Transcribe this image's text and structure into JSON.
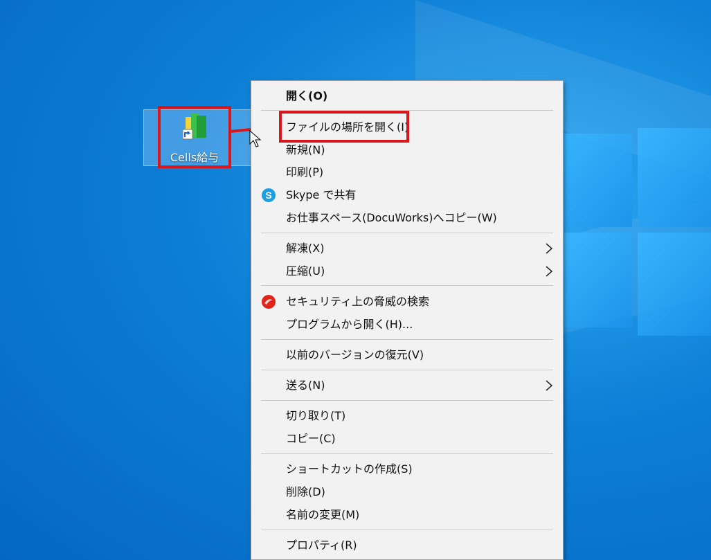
{
  "desktop": {
    "icon_label": "Cells給与",
    "icon_name": "cells-kyuyo-shortcut-icon"
  },
  "annotation": {
    "highlight_color": "#d8161b"
  },
  "menu": {
    "items": [
      {
        "label": "開く(O)",
        "bold": true
      },
      {
        "label": "ファイルの場所を開く(I)"
      },
      {
        "label": "新規(N)"
      },
      {
        "label": "印刷(P)"
      },
      {
        "label": "Skype で共有",
        "icon": "skype-icon"
      },
      {
        "label": "お仕事スペース(DocuWorks)へコピー(W)"
      },
      {
        "label": "解凍(X)",
        "submenu": true
      },
      {
        "label": "圧縮(U)",
        "submenu": true
      },
      {
        "label": "セキュリティ上の脅威の検索",
        "icon": "security-scan-icon"
      },
      {
        "label": "プログラムから開く(H)..."
      },
      {
        "label": "以前のバージョンの復元(V)"
      },
      {
        "label": "送る(N)",
        "submenu": true
      },
      {
        "label": "切り取り(T)"
      },
      {
        "label": "コピー(C)"
      },
      {
        "label": "ショートカットの作成(S)"
      },
      {
        "label": "削除(D)"
      },
      {
        "label": "名前の変更(M)"
      },
      {
        "label": "プロパティ(R)"
      }
    ]
  }
}
